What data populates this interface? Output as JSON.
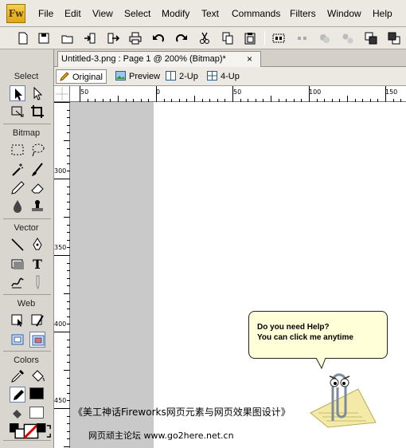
{
  "app": {
    "logo_text": "Fw"
  },
  "menu": [
    "File",
    "Edit",
    "View",
    "Select",
    "Modify",
    "Text",
    "Commands",
    "Filters",
    "Window",
    "Help"
  ],
  "toolbar": {
    "buttons": [
      "new-document-icon",
      "save-icon",
      "open-icon",
      "import-icon",
      "export-icon",
      "print-icon",
      "undo-icon",
      "redo-icon",
      "cut-icon",
      "copy-icon",
      "paste-icon",
      "group-icon",
      "ungroup-icon",
      "join-icon",
      "split-icon",
      "bring-to-front-icon",
      "send-to-back-icon"
    ]
  },
  "tools": {
    "sections": {
      "select": "Select",
      "bitmap": "Bitmap",
      "vector": "Vector",
      "web": "Web",
      "colors": "Colors"
    }
  },
  "document": {
    "tab_title": "Untitled-3.png : Page 1 @ 200% (Bitmap)*",
    "close_glyph": "×"
  },
  "views": [
    "Original",
    "Preview",
    "2-Up",
    "4-Up"
  ],
  "rulers": {
    "top": [
      "50",
      "0",
      "50",
      "100",
      "150"
    ],
    "left": [
      "300",
      "350",
      "400",
      "450"
    ]
  },
  "assistant": {
    "line1": "Do you need Help?",
    "line2": "You can click me anytime"
  },
  "watermark": {
    "line1": "《美工神话Fireworks网页元素与网页效果图设计》",
    "line2": "网页顽主论坛 www.go2here.net.cn"
  },
  "colors": {
    "stroke": "#000000",
    "fill": "#ffffff"
  }
}
